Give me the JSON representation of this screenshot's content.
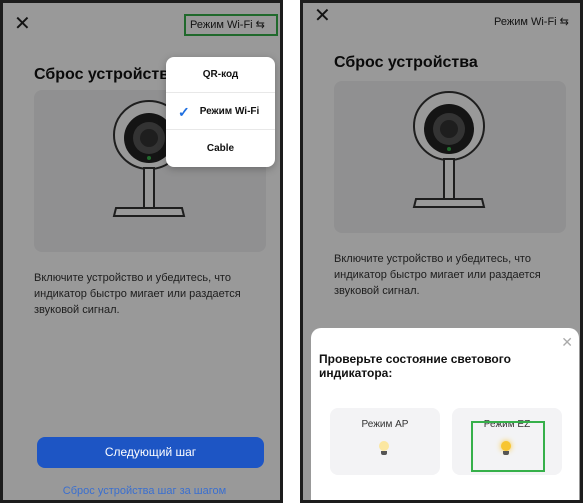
{
  "left": {
    "mode_label": "Режим Wi-Fi ⇆",
    "title": "Сброс устройства",
    "description": "Включите устройство и убедитесь, что индикатор быстро мигает или раздается звуковой сигнал.",
    "menu": {
      "items": [
        {
          "label": "QR-код",
          "selected": false
        },
        {
          "label": "Режим Wi-Fi",
          "selected": true
        },
        {
          "label": "Cable",
          "selected": false
        }
      ]
    },
    "next_button": "Следующий шаг",
    "step_link": "Сброс устройства шаг за шагом"
  },
  "right": {
    "mode_label": "Режим Wi-Fi ⇆",
    "title": "Сброс устройства",
    "description": "Включите устройство и убедитесь, что индикатор быстро мигает или раздается звуковой сигнал.",
    "sheet": {
      "title": "Проверьте состояние светового индикатора:",
      "options": [
        {
          "label": "Режим AP",
          "bulb_color": "#fbe7a1"
        },
        {
          "label": "Режим EZ",
          "bulb_color": "#f7c531"
        }
      ]
    }
  },
  "colors": {
    "accent": "#1d55c4",
    "link": "#3a6fd0",
    "highlight": "#36b04a"
  }
}
